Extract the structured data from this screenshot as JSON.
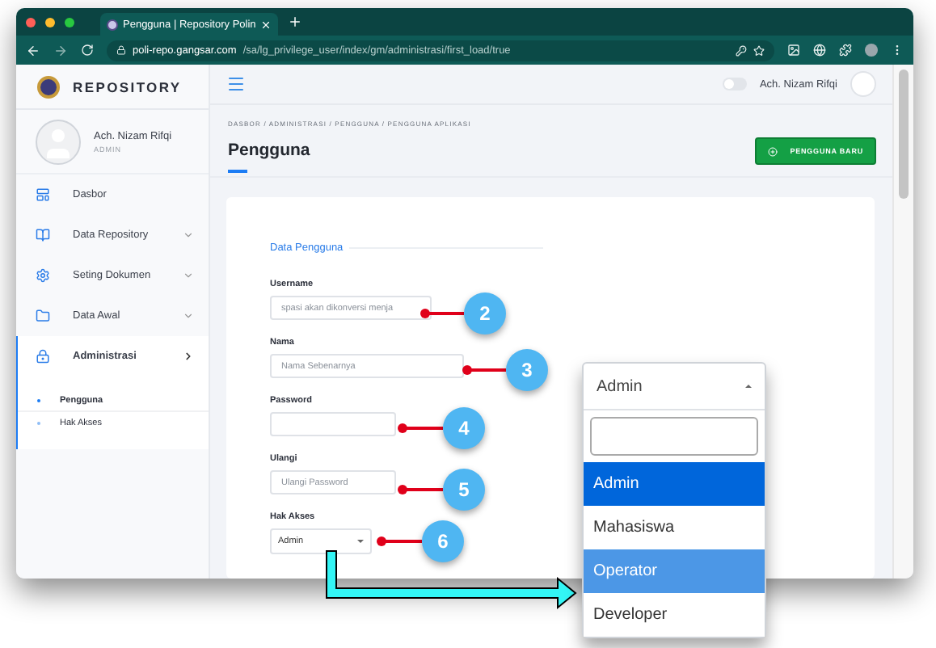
{
  "browser": {
    "tab_title": "Pengguna | Repository Polin",
    "url_host": "poli-repo.gangsar.com",
    "url_path": "/sa/lg_privilege_user/index/gm/administrasi/first_load/true"
  },
  "brand": "REPOSITORY",
  "topbar": {
    "dark_mode": {
      "on": false
    },
    "user_name": "Ach. Nizam Rifqi"
  },
  "profile": {
    "name": "Ach. Nizam Rifqi",
    "role": "ADMIN"
  },
  "sidebar": {
    "items": [
      {
        "label": "Dasbor",
        "selected": false
      },
      {
        "label": "Data Repository",
        "selected": false,
        "expanded": false
      },
      {
        "label": "Seting Dokumen",
        "selected": false,
        "expanded": false
      },
      {
        "label": "Data Awal",
        "selected": false,
        "expanded": false
      },
      {
        "label": "Administrasi",
        "selected": true,
        "expanded": true,
        "children": [
          {
            "label": "Pengguna",
            "selected": true
          },
          {
            "label": "Hak Akses",
            "selected": false
          }
        ]
      }
    ]
  },
  "breadcrumb": "DASBOR  /  ADMINISTRASI  /  PENGGUNA  /  PENGGUNA APLIKASI",
  "page_title": "Pengguna",
  "new_button": "PENGGUNA BARU",
  "section_title": "Data Pengguna",
  "fields": [
    {
      "kind": "text",
      "label": "Username",
      "placeholder": "spasi akan dikonversi menja"
    },
    {
      "kind": "text",
      "label": "Nama",
      "placeholder": "Nama Sebenarnya"
    },
    {
      "kind": "text",
      "label": "Password"
    },
    {
      "kind": "text",
      "label": "Ulangi",
      "placeholder": "Ulangi Password"
    },
    {
      "kind": "select",
      "label": "Hak Akses",
      "value": "Admin"
    }
  ],
  "callouts": [
    "2",
    "3",
    "4",
    "5",
    "6"
  ],
  "dropdown": {
    "value": "Admin",
    "options": [
      {
        "label": "Admin",
        "selected": true,
        "hovered": false
      },
      {
        "label": "Mahasiswa",
        "selected": false,
        "hovered": false
      },
      {
        "label": "Operator",
        "selected": false,
        "hovered": true
      },
      {
        "label": "Developer",
        "selected": false,
        "hovered": false
      }
    ]
  }
}
